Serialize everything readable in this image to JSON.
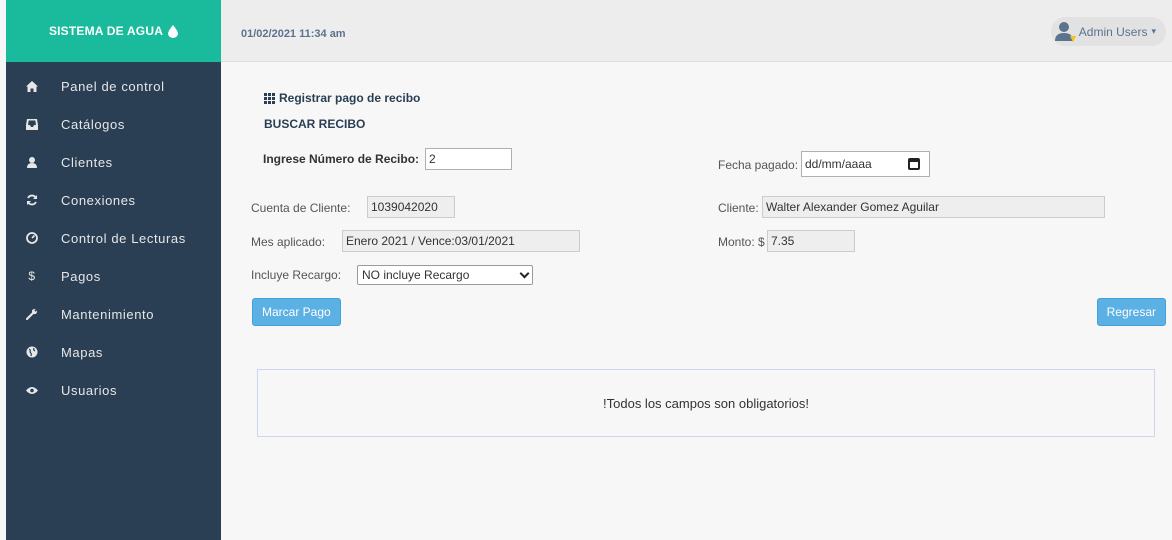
{
  "app": {
    "brand": "SISTEMA DE AGUA"
  },
  "header": {
    "datetime": "01/02/2021 11:34 am",
    "user": "Admin Users"
  },
  "sidebar": {
    "items": [
      {
        "label": "Panel de control",
        "icon": "home-icon"
      },
      {
        "label": "Catálogos",
        "icon": "inbox-icon"
      },
      {
        "label": "Clientes",
        "icon": "user-icon"
      },
      {
        "label": "Conexiones",
        "icon": "refresh-icon"
      },
      {
        "label": "Control de Lecturas",
        "icon": "dashboard-icon"
      },
      {
        "label": "Pagos",
        "icon": "dollar-icon"
      },
      {
        "label": "Mantenimiento",
        "icon": "wrench-icon"
      },
      {
        "label": "Mapas",
        "icon": "globe-icon"
      },
      {
        "label": "Usuarios",
        "icon": "eye-icon"
      }
    ]
  },
  "form": {
    "title": "Registrar pago de recibo",
    "subtitle": "BUSCAR RECIBO",
    "recibo_label": "Ingrese Número de Recibo:",
    "recibo_value": "2",
    "fecha_label": "Fecha pagado:",
    "fecha_placeholder": "dd/mm/aaaa",
    "cuenta_label": "Cuenta de Cliente:",
    "cuenta_value": "1039042020",
    "cliente_label": "Cliente:",
    "cliente_value": "Walter Alexander Gomez Aguilar",
    "mes_label": "Mes aplicado:",
    "mes_value": "Enero 2021 / Vence:03/01/2021",
    "monto_label": "Monto: $",
    "monto_value": "7.35",
    "recargo_label": "Incluye Recargo:",
    "recargo_selected": "NO incluye Recargo",
    "marcar_button": "Marcar Pago",
    "regresar_button": "Regresar",
    "alert": "!Todos los campos son obligatorios!"
  },
  "colors": {
    "sidebar": "#2A3F54",
    "brand": "#1ABB9C",
    "button": "#5BB0E4"
  }
}
